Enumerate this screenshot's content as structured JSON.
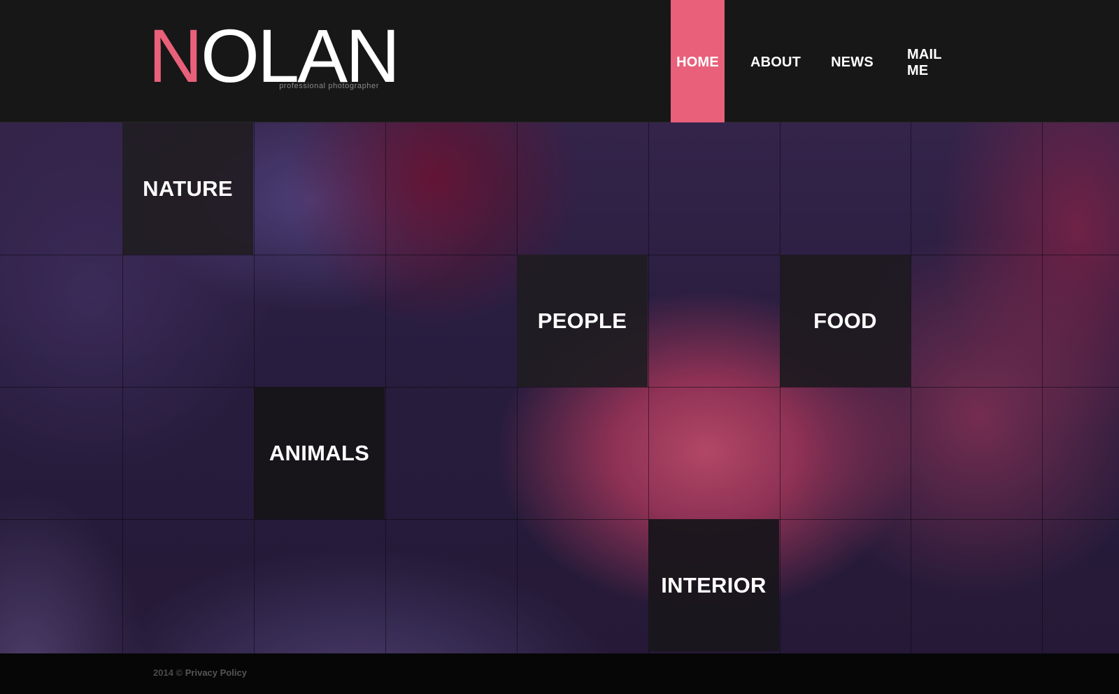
{
  "header": {
    "logo": {
      "first_letter": "N",
      "rest": "OLAN",
      "tagline": "professional photographer"
    },
    "nav": {
      "items": [
        {
          "label": "HOME",
          "active": true
        },
        {
          "label": "ABOUT",
          "active": false
        },
        {
          "label": "NEWS",
          "active": false
        },
        {
          "label": "MAIL ME",
          "active": false
        }
      ]
    }
  },
  "gallery": {
    "categories": [
      {
        "label": "NATURE"
      },
      {
        "label": "PEOPLE"
      },
      {
        "label": "FOOD"
      },
      {
        "label": "ANIMALS"
      },
      {
        "label": "INTERIOR"
      }
    ]
  },
  "footer": {
    "year": "2014 ©",
    "privacy_label": "Privacy Policy"
  },
  "colors": {
    "accent": "#e8607a",
    "header_bg": "#161616",
    "footer_bg": "#060606",
    "tile_bg": "#1e1a20"
  }
}
